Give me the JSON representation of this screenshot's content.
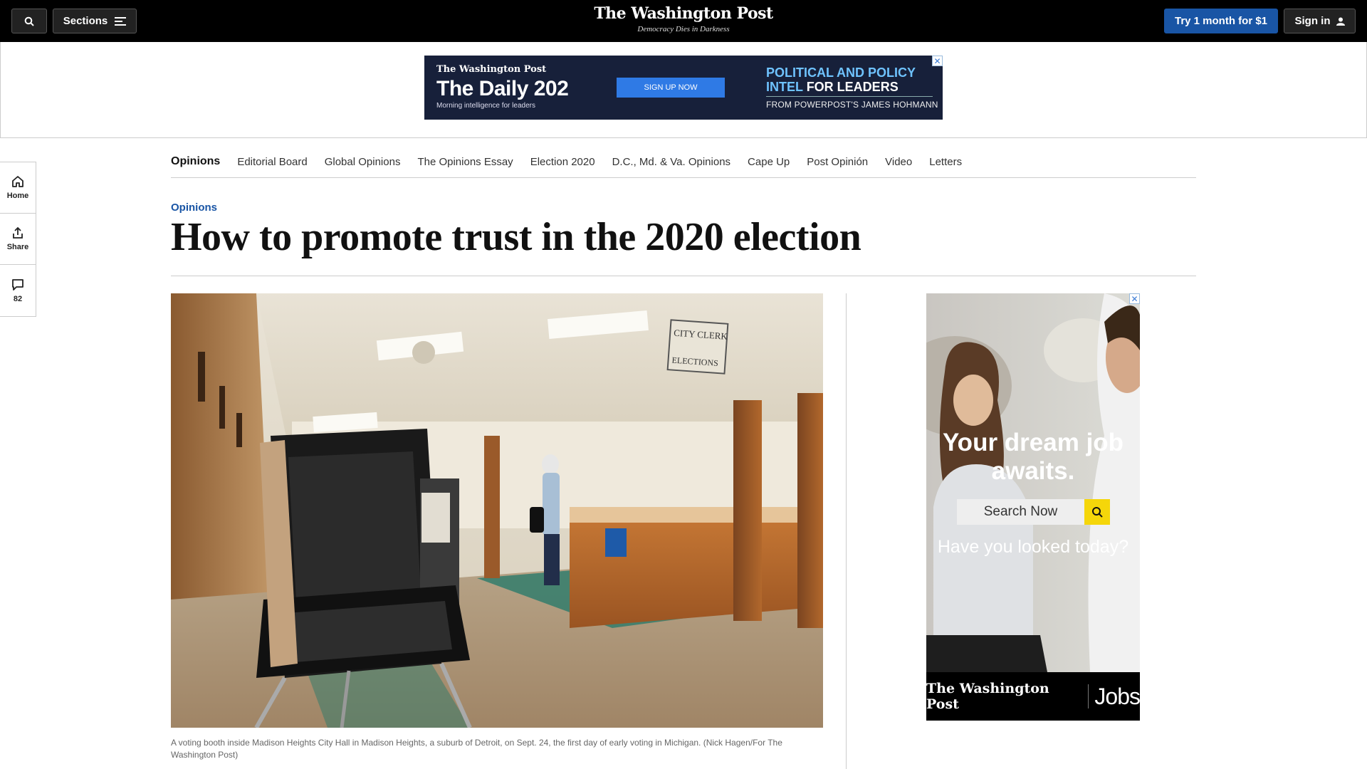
{
  "header": {
    "sections_label": "Sections",
    "logo": "The Washington Post",
    "tagline": "Democracy Dies in Darkness",
    "subscribe_label": "Try 1 month for $1",
    "signin_label": "Sign in"
  },
  "top_ad": {
    "logo": "The Washington Post",
    "title": "The Daily 202",
    "subtitle": "Morning intelligence for leaders",
    "cta": "SIGN UP NOW",
    "headline_blue": "POLITICAL AND POLICY INTEL",
    "headline_white": "FOR LEADERS",
    "from": "FROM POWERPOST'S JAMES HOHMANN"
  },
  "rail": {
    "home_label": "Home",
    "share_label": "Share",
    "comments_count": "82"
  },
  "subnav": {
    "items": [
      "Opinions",
      "Editorial Board",
      "Global Opinions",
      "The Opinions Essay",
      "Election 2020",
      "D.C., Md. & Va. Opinions",
      "Cape Up",
      "Post Opinión",
      "Video",
      "Letters"
    ]
  },
  "article": {
    "kicker": "Opinions",
    "headline": "How to promote trust in the 2020 election",
    "caption": "A voting booth inside Madison Heights City Hall in Madison Heights, a suburb of Detroit, on Sept. 24, the first day of early voting in Michigan. (Nick Hagen/For The Washington Post)",
    "photo_sign": "CITY CLERK\nBIRTH · DEATH RECORDS\nELECTIONS"
  },
  "side_ad": {
    "copy1": "Your dream job awaits.",
    "search_label": "Search Now",
    "copy2": "Have you looked today?",
    "brand": "The Washington Post",
    "jobs": "Jobs"
  },
  "colors": {
    "brand_blue": "#1955a5",
    "topbar": "#000000",
    "ad_navy": "#17203a"
  }
}
